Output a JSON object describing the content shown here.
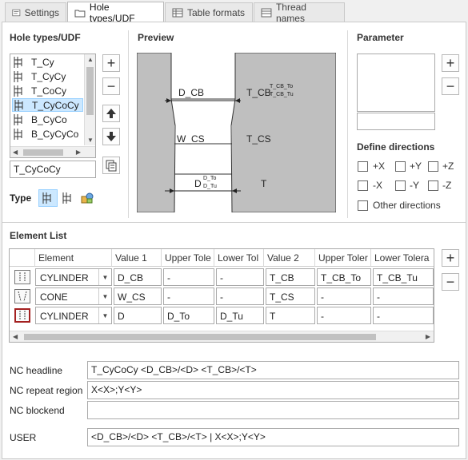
{
  "tabs": [
    {
      "label": "Settings"
    },
    {
      "label": "Hole types/UDF"
    },
    {
      "label": "Table formats"
    },
    {
      "label": "Thread names"
    }
  ],
  "hole_types": {
    "title": "Hole types/UDF",
    "items": [
      "T_Cy",
      "T_CyCy",
      "T_CoCy",
      "T_CyCoCy",
      "B_CyCo",
      "B_CyCyCo"
    ],
    "selected": "T_CyCoCy",
    "name_value": "T_CyCoCy",
    "type_label": "Type"
  },
  "preview": {
    "title": "Preview",
    "labels": {
      "d_cb": "D_CB",
      "t_cb": "T_CB",
      "t_cb_to": "T_CB_To",
      "t_cb_tu": "T_CB_Tu",
      "w_cs": "W_CS",
      "t_cs": "T_CS",
      "d": "D",
      "d_to": "D_To",
      "d_tu": "D_Tu",
      "t": "T"
    }
  },
  "parameter": {
    "title": "Parameter",
    "directions_title": "Define directions",
    "directions": [
      "+X",
      "+Y",
      "+Z",
      "-X",
      "-Y",
      "-Z"
    ],
    "other": "Other directions"
  },
  "element_list": {
    "title": "Element List",
    "columns": [
      "Element",
      "Value 1",
      "Upper Tole",
      "Lower Tol",
      "Value 2",
      "Upper Toler",
      "Lower Tolera"
    ],
    "rows": [
      {
        "icon": "cylinder-icon",
        "element": "CYLINDER",
        "v1": "D_CB",
        "ut1": "-",
        "lt1": "-",
        "v2": "T_CB",
        "ut2": "T_CB_To",
        "lt2": "T_CB_Tu"
      },
      {
        "icon": "cone-icon",
        "element": "CONE",
        "v1": "W_CS",
        "ut1": "-",
        "lt1": "-",
        "v2": "T_CS",
        "ut2": "-",
        "lt2": "-"
      },
      {
        "icon": "cylinder-icon",
        "element": "CYLINDER",
        "v1": "D",
        "ut1": "D_To",
        "lt1": "D_Tu",
        "v2": "T",
        "ut2": "-",
        "lt2": "-"
      }
    ]
  },
  "nc": {
    "headline_label": "NC headline",
    "headline_value": "T_CyCoCy <D_CB>/<D> <T_CB>/<T>",
    "repeat_label": "NC repeat region",
    "repeat_value": "X<X>;Y<Y>",
    "blockend_label": "NC blockend",
    "blockend_value": "",
    "user_label": "USER",
    "user_value": "<D_CB>/<D> <T_CB>/<T> | X<X>;Y<Y>"
  },
  "colors": {
    "selection": "#cce8ff",
    "preview_bg": "#bfbfbf",
    "panel_border": "#c9c9c9"
  }
}
